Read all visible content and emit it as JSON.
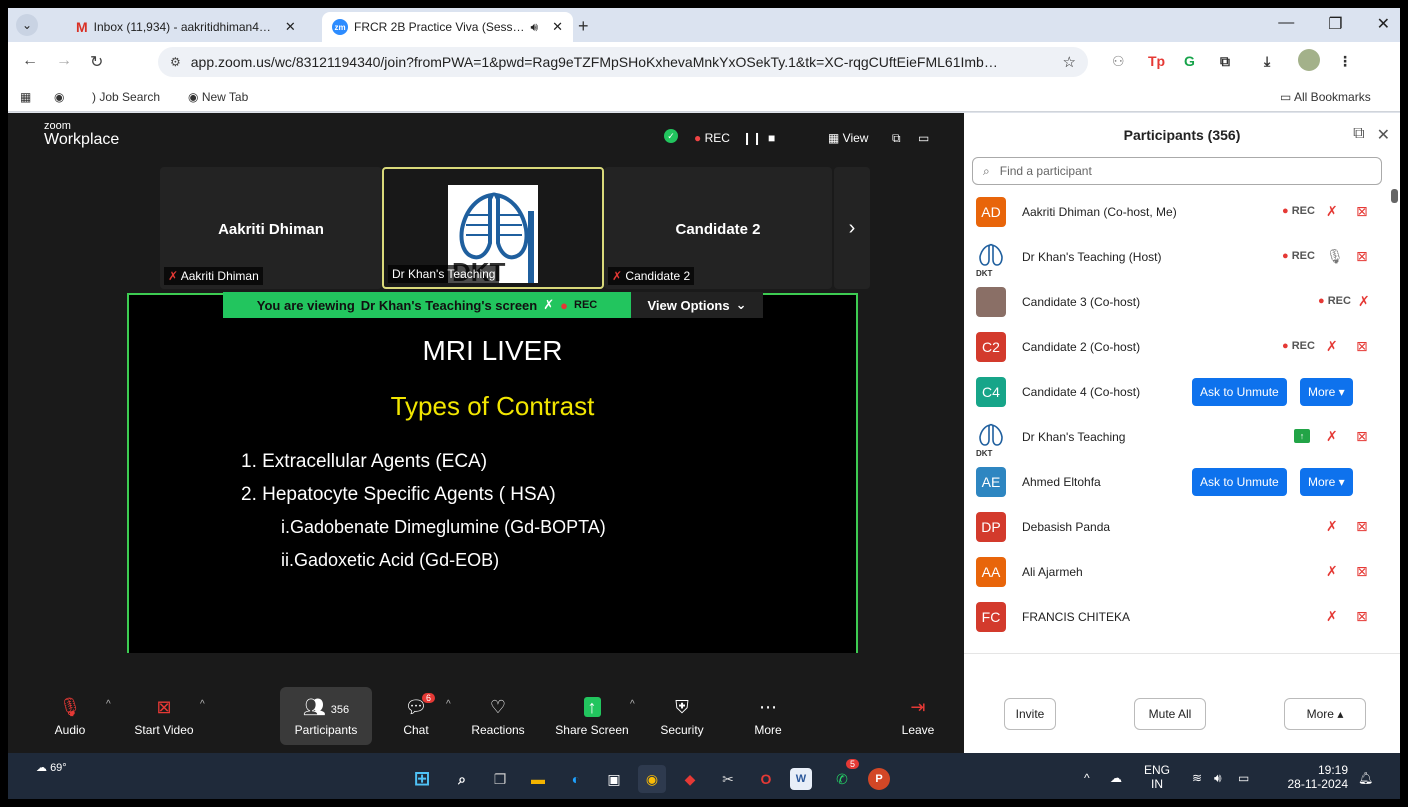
{
  "browser": {
    "tabs": [
      {
        "title": "Inbox (11,934) - aakritidhiman4…",
        "favicon": "gmail-icon",
        "active": false
      },
      {
        "title": "FRCR 2B Practice Viva (Sess…",
        "favicon": "zoom-icon",
        "active": true
      }
    ],
    "zoom_favicon_text": "zm",
    "gmail_favicon_text": "M",
    "url": "app.zoom.us/wc/83121194340/join?fromPWA=1&pwd=Rag9eTZFMpSHoKxhevaMnkYxOSekTy.1&tk=XC-rqgCUftEieFML61Imb…",
    "bookmarks": [
      "Job Search",
      "New Tab"
    ],
    "all_bookmarks": "All Bookmarks",
    "extensions": [
      "Tp",
      "G"
    ]
  },
  "zoom": {
    "brand_small": "zoom",
    "brand_big": "Workplace",
    "rec_label": "REC",
    "view_label": "View",
    "tiles": [
      {
        "name": "Aakriti Dhiman",
        "label": "Aakriti Dhiman"
      },
      {
        "name": "",
        "label": "Dr Khan's Teaching"
      },
      {
        "name": "Candidate 2",
        "label": "Candidate 2"
      }
    ],
    "logo_text": "DKT",
    "banner_prefix": "You are viewing",
    "banner_name": "Dr Khan's Teaching's screen",
    "banner_rec": "REC",
    "view_options": "View Options",
    "slide": {
      "title": "MRI LIVER",
      "subtitle": "Types of Contrast",
      "items": [
        "1.  Extracellular Agents  (ECA)",
        "2.  Hepatocyte Specific Agents ( HSA)"
      ],
      "subitems": [
        "i.Gadobenate Dimeglumine (Gd-BOPTA)",
        "ii.Gadoxetic Acid (Gd-EOB)"
      ]
    },
    "controls": {
      "audio": "Audio",
      "start_video": "Start Video",
      "participants": "Participants",
      "participants_count": "356",
      "chat": "Chat",
      "chat_badge": "6",
      "reactions": "Reactions",
      "share_screen": "Share Screen",
      "security": "Security",
      "more": "More",
      "leave": "Leave"
    }
  },
  "panel": {
    "title": "Participants (356)",
    "search_placeholder": "Find a participant",
    "participants": [
      {
        "initials": "AD",
        "color": "#e8650a",
        "name": "Aakriti Dhiman (Co-host, Me)",
        "rec": true,
        "actions": false
      },
      {
        "initials": "DKT",
        "color": "#ffffff",
        "name": "Dr Khan's Teaching (Host)",
        "rec": true,
        "actions": false
      },
      {
        "initials": "",
        "color": "#8a6f66",
        "name": "Candidate 3 (Co-host)",
        "rec": true,
        "actions": false
      },
      {
        "initials": "C2",
        "color": "#d33a2c",
        "name": "Candidate 2 (Co-host)",
        "rec": true,
        "actions": false
      },
      {
        "initials": "C4",
        "color": "#17a589",
        "name": "Candidate 4 (Co-host)",
        "rec": false,
        "actions": true
      },
      {
        "initials": "DKT",
        "color": "#ffffff",
        "name": "Dr Khan's Teaching",
        "rec": false,
        "actions": false
      },
      {
        "initials": "AE",
        "color": "#2e86c1",
        "name": "Ahmed Eltohfa",
        "rec": false,
        "actions": true
      },
      {
        "initials": "DP",
        "color": "#d33a2c",
        "name": "Debasish Panda",
        "rec": false,
        "actions": false
      },
      {
        "initials": "AA",
        "color": "#e8650a",
        "name": "Ali Ajarmeh",
        "rec": false,
        "actions": false
      },
      {
        "initials": "FC",
        "color": "#d33a2c",
        "name": "FRANCIS CHITEKA",
        "rec": false,
        "actions": false
      }
    ],
    "ask_to_unmute": "Ask to Unmute",
    "more_button": "More",
    "invite": "Invite",
    "mute_all": "Mute All",
    "more_footer": "More"
  },
  "taskbar": {
    "temperature": "69°",
    "lang_top": "ENG",
    "lang_bottom": "IN",
    "time": "19:19",
    "date": "28-11-2024",
    "whatsapp_badge": "5"
  }
}
